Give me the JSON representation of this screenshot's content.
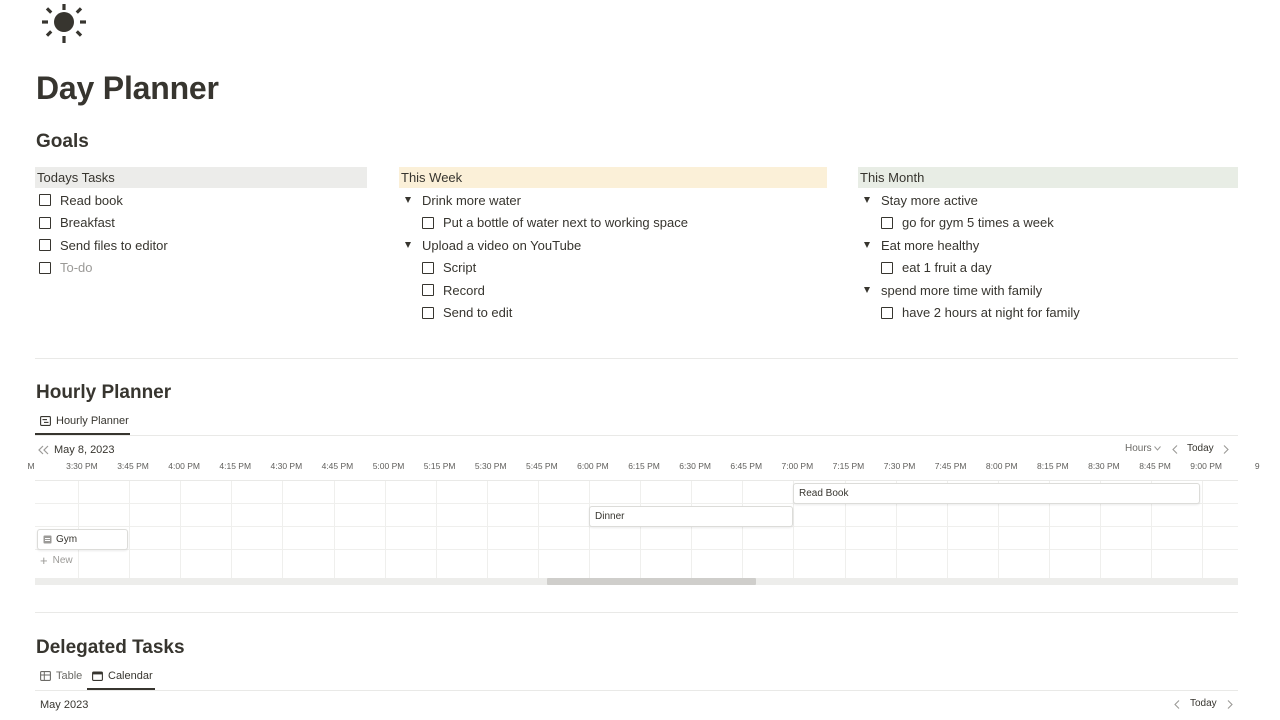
{
  "page": {
    "icon": "sun-icon",
    "title": "Day Planner"
  },
  "goals": {
    "heading": "Goals",
    "todays_tasks": {
      "header": "Todays Tasks",
      "header_bg": "#ececea",
      "items": [
        "Read book",
        "Breakfast",
        "Send files to editor"
      ],
      "new_item_placeholder": "To-do"
    },
    "this_week": {
      "header": "This Week",
      "header_bg": "#fbf0d8",
      "groups": [
        {
          "title": "Drink more water",
          "items": [
            "Put a bottle of water next to working space"
          ]
        },
        {
          "title": "Upload a video on YouTube",
          "items": [
            "Script",
            "Record",
            "Send to edit"
          ]
        }
      ]
    },
    "this_month": {
      "header": "This Month",
      "header_bg": "#e8ede5",
      "groups": [
        {
          "title": "Stay more active",
          "items": [
            "go for gym 5 times a week"
          ]
        },
        {
          "title": "Eat more healthy",
          "items": [
            "eat 1 fruit a day"
          ]
        },
        {
          "title": "spend more time with family",
          "items": [
            "have 2 hours at night for family"
          ]
        }
      ]
    }
  },
  "hourly": {
    "heading": "Hourly Planner",
    "tab_label": "Hourly Planner",
    "date": "May 8, 2023",
    "zoom": "Hours",
    "today": "Today",
    "times": [
      "M",
      "3:30 PM",
      "3:45 PM",
      "4:00 PM",
      "4:15 PM",
      "4:30 PM",
      "4:45 PM",
      "5:00 PM",
      "5:15 PM",
      "5:30 PM",
      "5:45 PM",
      "6:00 PM",
      "6:15 PM",
      "6:30 PM",
      "6:45 PM",
      "7:00 PM",
      "7:15 PM",
      "7:30 PM",
      "7:45 PM",
      "8:00 PM",
      "8:15 PM",
      "8:30 PM",
      "8:45 PM",
      "9:00 PM",
      "9"
    ],
    "events": {
      "read_book": "Read Book",
      "dinner": "Dinner",
      "gym": "Gym"
    },
    "new_label": "New"
  },
  "delegated": {
    "heading": "Delegated Tasks",
    "tabs": [
      "Table",
      "Calendar"
    ],
    "month": "May 2023",
    "today": "Today"
  }
}
